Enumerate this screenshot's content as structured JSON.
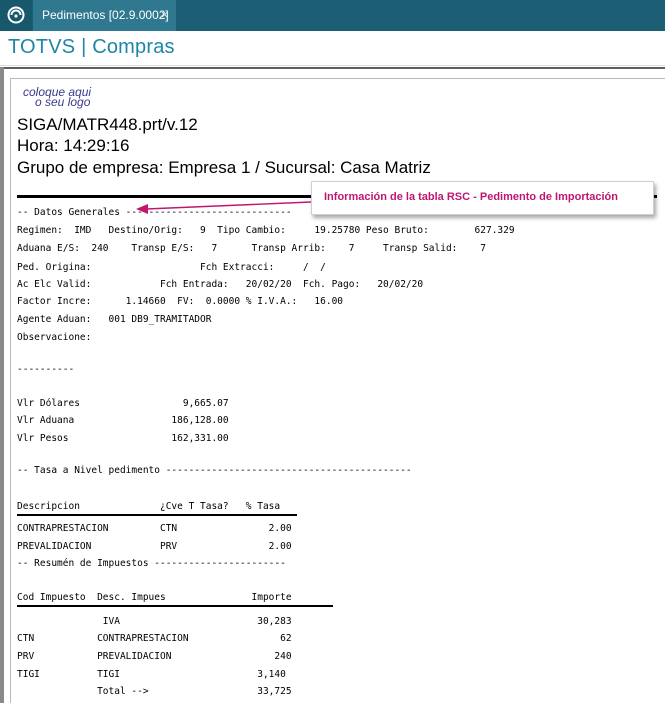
{
  "tabbar": {
    "tab_label": "Pedimentos [02.9.0002]",
    "close_glyph": "×"
  },
  "header": {
    "brand": "TOTVS | Compras"
  },
  "report": {
    "logo_line1": "coloque aqui",
    "logo_line2": "o seu logo",
    "program": "SIGA/MATR448.prt/v.12",
    "time": "Hora: 14:29:16",
    "group": "Grupo de empresa: Empresa 1 / Sucursal: Casa Matriz",
    "datos_generales": "-- Datos Generales -----------------------------",
    "line_regimen": "Regimen:  IMD   Destino/Orig:   9  Tipo Cambio:     19.25780 Peso Bruto:        627.329",
    "line_aduana": "Aduana E/S:  240    Transp E/S:   7      Transp Arrib:    7     Transp Salid:    7",
    "line_ped": "Ped. Origina:                   Fch Extracci:     /  /",
    "line_ac": "Ac Elc Valid:            Fch Entrada:   20/02/20  Fch. Pago:   20/02/20",
    "line_factor": "Factor Incre:      1.14660  FV:  0.0000 % I.V.A.:   16.00",
    "line_agente": "Agente Aduan:   001 DB9_TRAMITADOR",
    "line_observ": "Observacione:",
    "dashes": "----------",
    "vlr_dolares": "Vlr Dólares                  9,665.07",
    "vlr_aduana": "Vlr Aduana                 186,128.00",
    "vlr_pesos": "Vlr Pesos                  162,331.00",
    "tasa_title": "-- Tasa a Nivel pedimento -------------------------------------------",
    "tasa_header": "Descripcion              ¿Cve T Tasa?   % Tasa",
    "tasa_row1": "CONTRAPRESTACION         CTN                2.00",
    "tasa_row2": "PREVALIDACION            PRV                2.00",
    "resumen_title": "-- Resumén de Impuestos -----------------------",
    "imp_header": "Cod Impuesto  Desc. Impues               Importe",
    "imp_row_iva": "               IVA                        30,283",
    "imp_row_ctn": "CTN           CONTRAPRESTACION                62",
    "imp_row_prv": "PRV           PREVALIDACION                  240",
    "imp_row_tigi": "TIGI          TIGI                        3,140",
    "imp_row_total": "              Total -->                   33,725"
  },
  "callout": {
    "text": "Información de la tabla RSC - Pedimento de Importación",
    "color": "#c0166f"
  },
  "colors": {
    "tabbar": "#1c5f75",
    "tab_active": "#2f7890",
    "brand": "#1e86a6"
  }
}
